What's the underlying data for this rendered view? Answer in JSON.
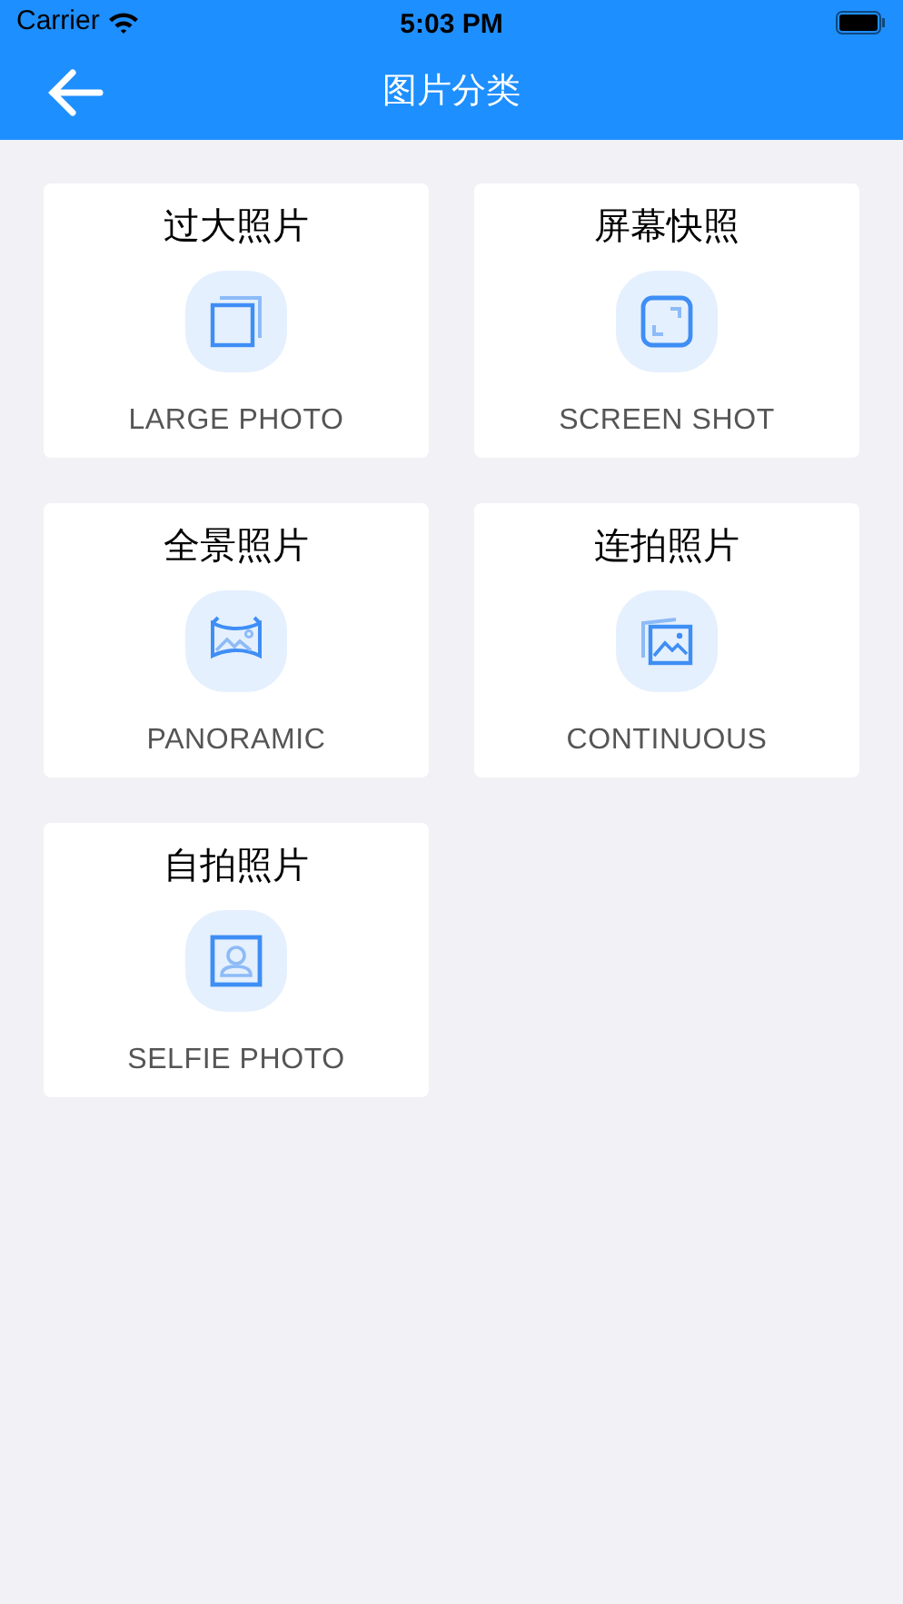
{
  "status_bar": {
    "carrier": "Carrier",
    "time": "5:03 PM"
  },
  "nav_bar": {
    "title": "图片分类"
  },
  "categories": [
    {
      "title": "过大照片",
      "subtitle": "LARGE PHOTO",
      "kind": "large"
    },
    {
      "title": "屏幕快照",
      "subtitle": "SCREEN SHOT",
      "kind": "screenshot"
    },
    {
      "title": "全景照片",
      "subtitle": "PANORAMIC",
      "kind": "panorama"
    },
    {
      "title": "连拍照片",
      "subtitle": "CONTINUOUS",
      "kind": "continuous"
    },
    {
      "title": "自拍照片",
      "subtitle": "SELFIE PHOTO",
      "kind": "selfie"
    }
  ]
}
